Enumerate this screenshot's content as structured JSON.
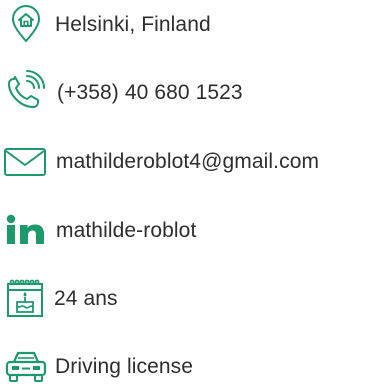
{
  "accent": "#1d9a6c",
  "contact": {
    "location": {
      "text": "Helsinki, Finland",
      "icon": "home-pin-icon"
    },
    "phone": {
      "text": "(+358) 40 680 1523",
      "icon": "phone-icon"
    },
    "email": {
      "text": "mathilderoblot4@gmail.com",
      "icon": "mail-icon"
    },
    "linkedin": {
      "text": "mathilde-roblot",
      "icon": "linkedin-icon"
    },
    "age": {
      "text": "24 ans",
      "icon": "birthday-calendar-icon"
    },
    "license": {
      "text": "Driving license",
      "icon": "car-icon"
    }
  }
}
